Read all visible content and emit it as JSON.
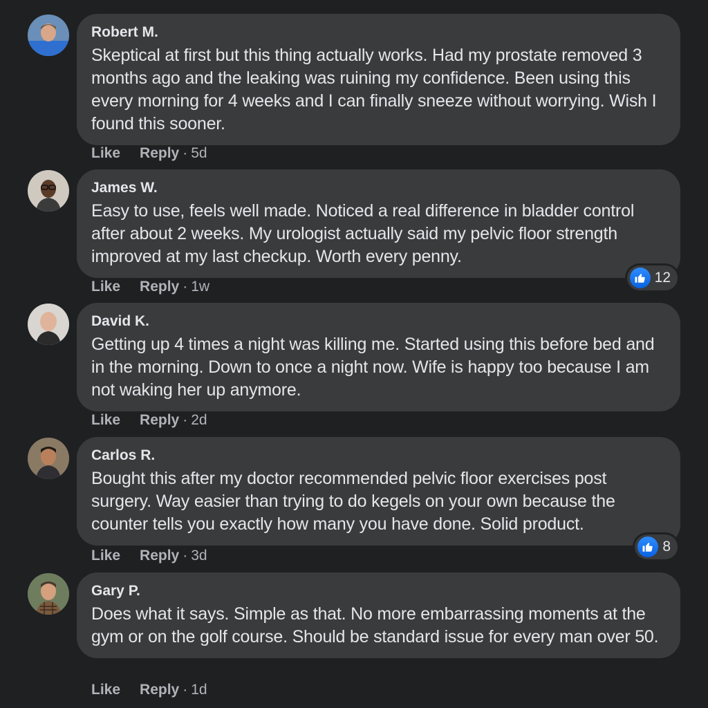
{
  "comments": [
    {
      "author": "Robert M.",
      "text": "Skeptical at first but this thing actually works. Had my prostate removed 3 months ago and the leaking was ruining my confidence. Been using this every morning for 4 weeks and I can finally sneeze without worrying. Wish I found this sooner.",
      "like_label": "Like",
      "reply_label": "Reply",
      "time": "5d",
      "reaction_count": null,
      "avatar_icon": "user-avatar"
    },
    {
      "author": "James W.",
      "text": "Easy to use, feels well made. Noticed a real difference in bladder control after about 2 weeks. My urologist actually said my pelvic floor strength improved at my last checkup. Worth every penny.",
      "like_label": "Like",
      "reply_label": "Reply",
      "time": "1w",
      "reaction_count": "12",
      "avatar_icon": "user-avatar"
    },
    {
      "author": "David K.",
      "text": "Getting up 4 times a night was killing me. Started using this before bed and in the morning. Down to once a night now. Wife is happy too because I am not waking her up anymore.",
      "like_label": "Like",
      "reply_label": "Reply",
      "time": "2d",
      "reaction_count": null,
      "avatar_icon": "user-avatar"
    },
    {
      "author": "Carlos R.",
      "text": "Bought this after my doctor recommended pelvic floor exercises post surgery. Way easier than trying to do kegels on your own because the counter tells you exactly how many you have done. Solid product.",
      "like_label": "Like",
      "reply_label": "Reply",
      "time": "3d",
      "reaction_count": "8",
      "avatar_icon": "user-avatar"
    },
    {
      "author": "Gary P.",
      "text": "Does what it says. Simple as that. No more embarrassing moments at the gym or on the golf course. Should be standard issue for every man over 50.",
      "like_label": "Like",
      "reply_label": "Reply",
      "time": "1d",
      "reaction_count": null,
      "avatar_icon": "user-avatar"
    }
  ],
  "separator": "·",
  "reaction_icon": "thumbs-up-icon",
  "colors": {
    "background": "#1f2022",
    "bubble": "#3a3b3c",
    "text": "#e4e6eb",
    "secondary_text": "#b0b3b8",
    "like_blue": "#1877f2"
  }
}
